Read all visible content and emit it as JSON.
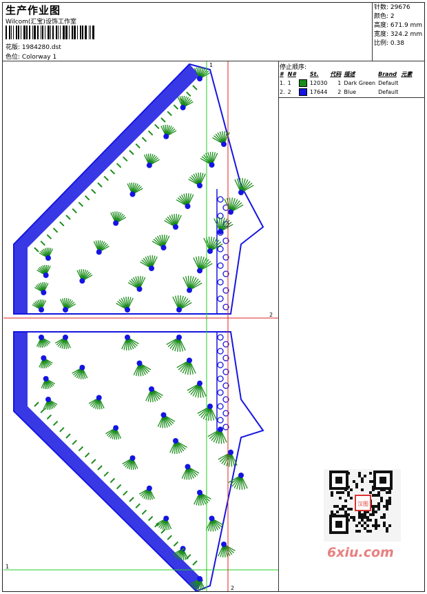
{
  "header": {
    "title": "生产作业图",
    "studio": "Wilcom(汇宝)设饰工作室",
    "design_label": "花版:",
    "design_file": "1984280.dst",
    "colorway_label": "色位:",
    "colorway": "Colorway 1"
  },
  "stats": [
    {
      "label": "针数:",
      "value": "29676"
    },
    {
      "label": "颜色:",
      "value": "2"
    },
    {
      "label": "高度:",
      "value": "671.9 mm"
    },
    {
      "label": "宽度:",
      "value": "324.2 mm"
    },
    {
      "label": "比例:",
      "value": "0.38"
    }
  ],
  "legend": {
    "heading": "停止顺序:",
    "columns": [
      "#",
      "N#",
      "St.",
      "代码",
      "描述",
      "Brand",
      "元素"
    ],
    "rows": [
      {
        "num": "1.",
        "needle": "1",
        "color": "#1a8c1a",
        "stitches": "12030",
        "code": "1",
        "description": "Dark Green",
        "brand": "Default"
      },
      {
        "num": "2.",
        "needle": "2",
        "color": "#1515e0",
        "stitches": "17644",
        "code": "2",
        "description": "Blue",
        "brand": "Default"
      }
    ]
  },
  "guides": {
    "green_label": "1",
    "red_label": "2"
  },
  "colors": {
    "green": "#1a8c1a",
    "blue": "#1515e0",
    "guide_green": "#22cc22",
    "guide_red": "#dd2222"
  },
  "watermark": {
    "text": "6xiu.com",
    "seal": "汉图"
  }
}
